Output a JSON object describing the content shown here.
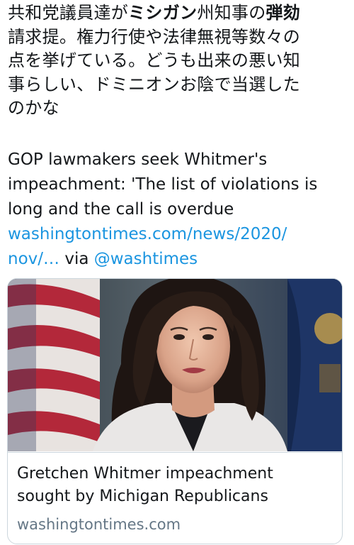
{
  "tweet": {
    "text_jp": {
      "l1_a": "共和党議員達が",
      "l1_b": "ミシガン",
      "l1_c": "州知事の",
      "l1_d": "弾劾",
      "l2": "請求提。権力行使や法律無視等数々の",
      "l3": "点を挙げている。どうも出来の悪い知",
      "l4": "事らしい、ドミニオンお陰で当選した",
      "l5": "のかな"
    },
    "text_en": {
      "line1": "GOP lawmakers seek Whitmer's",
      "line2": "impeachment: 'The list of violations is",
      "line3": "long and the call is overdue",
      "link_line1": "washingtontimes.com/news/2020/",
      "link_line2": "nov/…",
      "via": " via ",
      "mention": "@washtimes"
    },
    "card": {
      "title_line1": "Gretchen Whitmer impeachment",
      "title_line2": "sought by Michigan Republicans",
      "domain": "washingtontimes.com"
    }
  },
  "colors": {
    "link": "#1b95e0",
    "text": "#14171a",
    "muted": "#657786",
    "border": "#ccd6dd"
  }
}
